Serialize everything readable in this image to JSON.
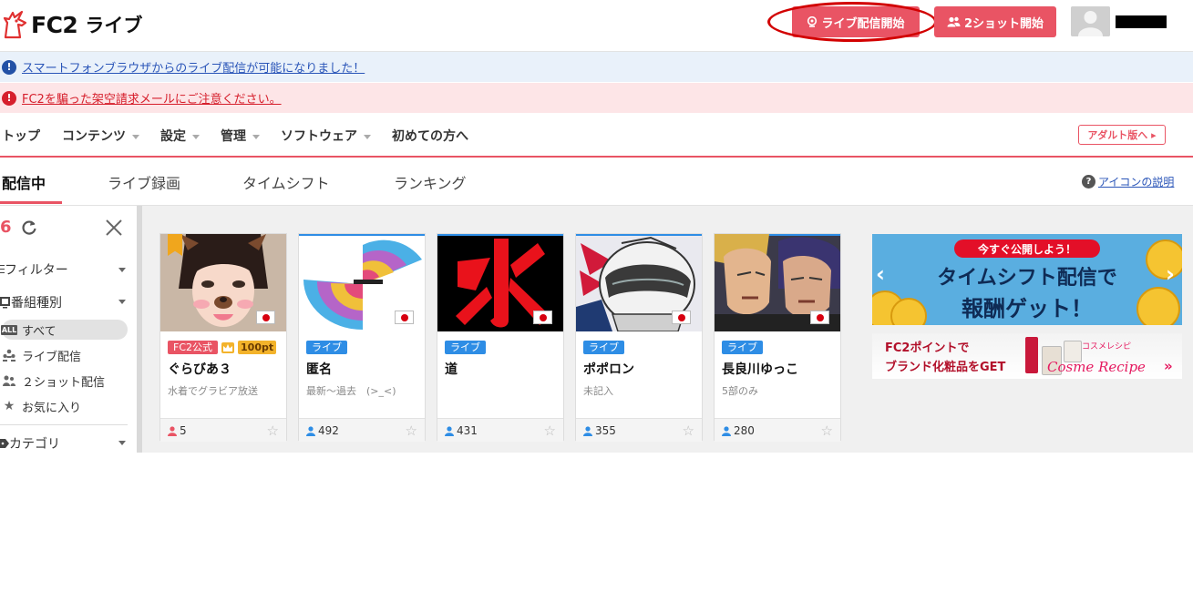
{
  "header": {
    "logo_fc2": "FC2",
    "logo_live": "ライブ",
    "live_start_label": "ライブ配信開始",
    "twoshot_start_label": "2ショット開始"
  },
  "notices": [
    {
      "text": "スマートフォンブラウザからのライブ配信が可能になりました！",
      "type": "info"
    },
    {
      "text": "FC2を騙った架空請求メールにご注意ください。",
      "type": "warning"
    }
  ],
  "mainnav": {
    "items": [
      {
        "label": "トップ",
        "dropdown": false
      },
      {
        "label": "コンテンツ",
        "dropdown": true
      },
      {
        "label": "設定",
        "dropdown": true
      },
      {
        "label": "管理",
        "dropdown": true
      },
      {
        "label": "ソフトウェア",
        "dropdown": true
      },
      {
        "label": "初めての方へ",
        "dropdown": false
      }
    ],
    "adult_label": "アダルト版へ ▸"
  },
  "subtabs": {
    "items": [
      "配信中",
      "ライブ録画",
      "タイムシフト",
      "ランキング"
    ],
    "active": "配信中",
    "help_label": "アイコンの説明"
  },
  "sidebar": {
    "count": "6",
    "filter_label": "フィルター",
    "program_type_label": "番組種別",
    "program_types": [
      "すべて",
      "ライブ配信",
      "２ショット配信",
      "お気に入り"
    ],
    "category_label": "カテゴリ",
    "all_badge": "ALL"
  },
  "cards": [
    {
      "name": "ぐらびあ３",
      "desc": "水着でグラビア放送",
      "tag": "FC2公式",
      "points": "100pt",
      "viewers": "5",
      "viewer_color": "#e95464"
    },
    {
      "name": "匿名",
      "desc": "最新～過去　(>_<)",
      "tag": "ライブ",
      "viewers": "492",
      "viewer_color": "#2e8de5"
    },
    {
      "name": "道",
      "desc": "",
      "tag": "ライブ",
      "viewers": "431",
      "viewer_color": "#2e8de5"
    },
    {
      "name": "ポポロン",
      "desc": "未記入",
      "tag": "ライブ",
      "viewers": "355",
      "viewer_color": "#2e8de5"
    },
    {
      "name": "長良川ゆっこ",
      "desc": "5部のみ",
      "tag": "ライブ",
      "viewers": "280",
      "viewer_color": "#2e8de5"
    }
  ],
  "banners": {
    "timeshift": {
      "pill": "今すぐ公開しよう！",
      "line1": "タイムシフト配信で",
      "line2": "報酬ゲット！"
    },
    "cosme": {
      "line1": "FC2ポイントで",
      "line2": "ブランド化粧品をGET",
      "brand_small": "コスメレシピ",
      "brand": "Cosme Recipe"
    }
  },
  "colors": {
    "accent": "#e95464",
    "live_blue": "#2e8de5",
    "annotation": "#d20000"
  }
}
